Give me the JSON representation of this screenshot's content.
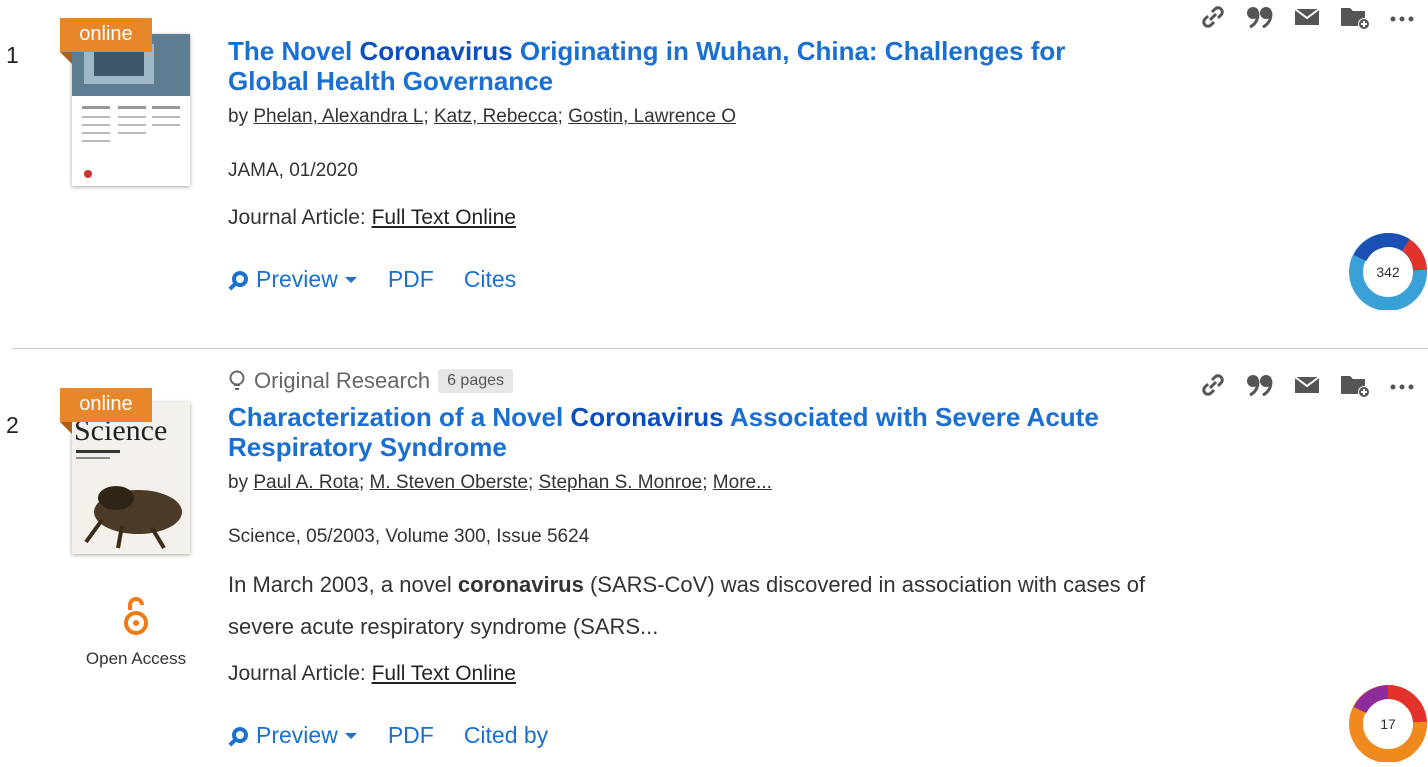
{
  "results": [
    {
      "index": "1",
      "badge": "online",
      "title_pre": "The Novel ",
      "title_bold": "Coronavirus",
      "title_post": " Originating in Wuhan, China: Challenges for Global Health Governance",
      "by": "by ",
      "authors": [
        "Phelan, Alexandra L",
        "Katz, Rebecca",
        "Gostin, Lawrence O"
      ],
      "meta": "JAMA, 01/2020",
      "type_label": "Journal Article: ",
      "type_link": "Full Text Online",
      "preview": "Preview",
      "pdf": "PDF",
      "cite_link": "Cites",
      "altmetric": "342"
    },
    {
      "index": "2",
      "badge": "online",
      "kicker": "Original Research",
      "pages": "6 pages",
      "title_pre": "Characterization of a Novel ",
      "title_bold": "Coronavirus",
      "title_post": " Associated with Severe Acute Respiratory Syndrome",
      "by": "by ",
      "authors": [
        "Paul A. Rota",
        "M. Steven Oberste",
        "Stephan S. Monroe",
        "More..."
      ],
      "meta": "Science, 05/2003, Volume 300, Issue 5624",
      "snippet_pre": "In March 2003, a novel ",
      "snippet_bold": "coronavirus",
      "snippet_post": " (SARS-CoV) was discovered in association with cases of severe acute respiratory syndrome (SARS...",
      "open_access": "Open Access",
      "type_label": "Journal Article: ",
      "type_link": "Full Text Online",
      "preview": "Preview",
      "pdf": "PDF",
      "cite_link": "Cited by",
      "altmetric": "17"
    }
  ],
  "colors": {
    "link": "#1a6fd1",
    "badge": "#e8862a",
    "oa": "#f07a16"
  },
  "icons": [
    "link-icon",
    "quote-icon",
    "email-icon",
    "folder-add-icon",
    "more-icon"
  ]
}
